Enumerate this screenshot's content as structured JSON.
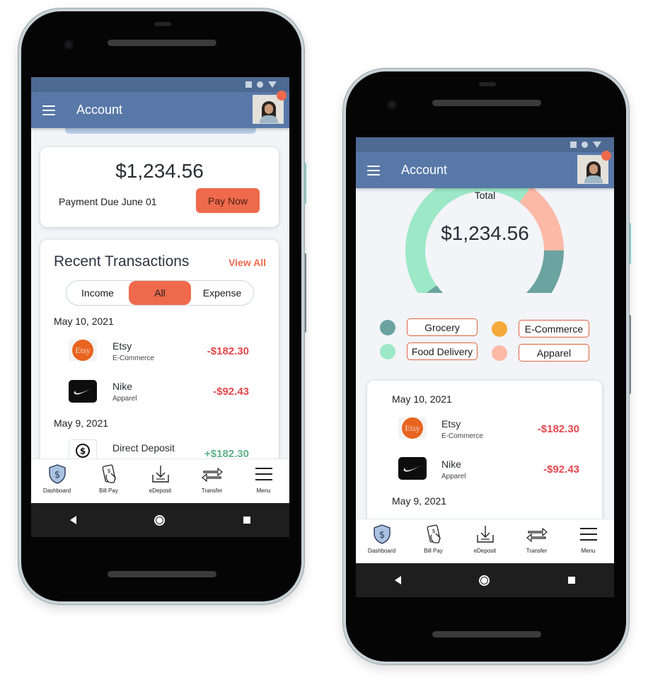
{
  "phone1": {
    "header": {
      "title": "Account"
    },
    "balance": {
      "amount": "$1,234.56",
      "due_label": "Payment Due June 01",
      "pay_button": "Pay Now"
    },
    "transactions": {
      "title": "Recent Transactions",
      "view_all": "View All",
      "tabs": [
        "Income",
        "All",
        "Expense"
      ],
      "active_tab": "All",
      "groups": [
        {
          "date": "May 10, 2021",
          "items": [
            {
              "logo": "Etsy",
              "name": "Etsy",
              "category": "E-Commerce",
              "amount": "-$182.30"
            },
            {
              "logo": "nike-swoosh-icon",
              "name": "Nike",
              "category": "Apparel",
              "amount": "-$92.43"
            }
          ]
        },
        {
          "date": "May 9, 2021",
          "items": [
            {
              "logo": "dollar-coin-icon",
              "name": "Direct Deposit",
              "category": "",
              "amount": "+$182.30"
            }
          ]
        }
      ]
    }
  },
  "phone2": {
    "header": {
      "title": "Account"
    },
    "chart_data": {
      "type": "pie",
      "title": "Total",
      "center_value": "$1,234.56",
      "categories": [
        "Grocery",
        "E-Commerce",
        "Food Delivery",
        "Apparel"
      ],
      "values": [
        40,
        0,
        45,
        15
      ],
      "colors": [
        "#6aa39f",
        "#f5a93b",
        "#9ce8c7",
        "#fbb9a6"
      ]
    },
    "transactions": {
      "groups": [
        {
          "date": "May 10, 2021",
          "items": [
            {
              "logo": "Etsy",
              "name": "Etsy",
              "category": "E-Commerce",
              "amount": "-$182.30"
            },
            {
              "logo": "nike-swoosh-icon",
              "name": "Nike",
              "category": "Apparel",
              "amount": "-$92.43"
            }
          ]
        },
        {
          "date": "May 9, 2021",
          "items": []
        }
      ]
    }
  },
  "bottom_nav": [
    {
      "label": "Dashboard",
      "icon": "shield-dollar-icon"
    },
    {
      "label": "Bill Pay",
      "icon": "bill-pay-icon"
    },
    {
      "label": "eDeposit",
      "icon": "edeposit-icon"
    },
    {
      "label": "Transfer",
      "icon": "transfer-arrows-icon"
    },
    {
      "label": "Menu",
      "icon": "menu-lines-icon"
    }
  ],
  "colors": {
    "primary": "#5878a8",
    "accent": "#ef6a4c",
    "negative": "#e5484d",
    "positive": "#5fb08a"
  }
}
